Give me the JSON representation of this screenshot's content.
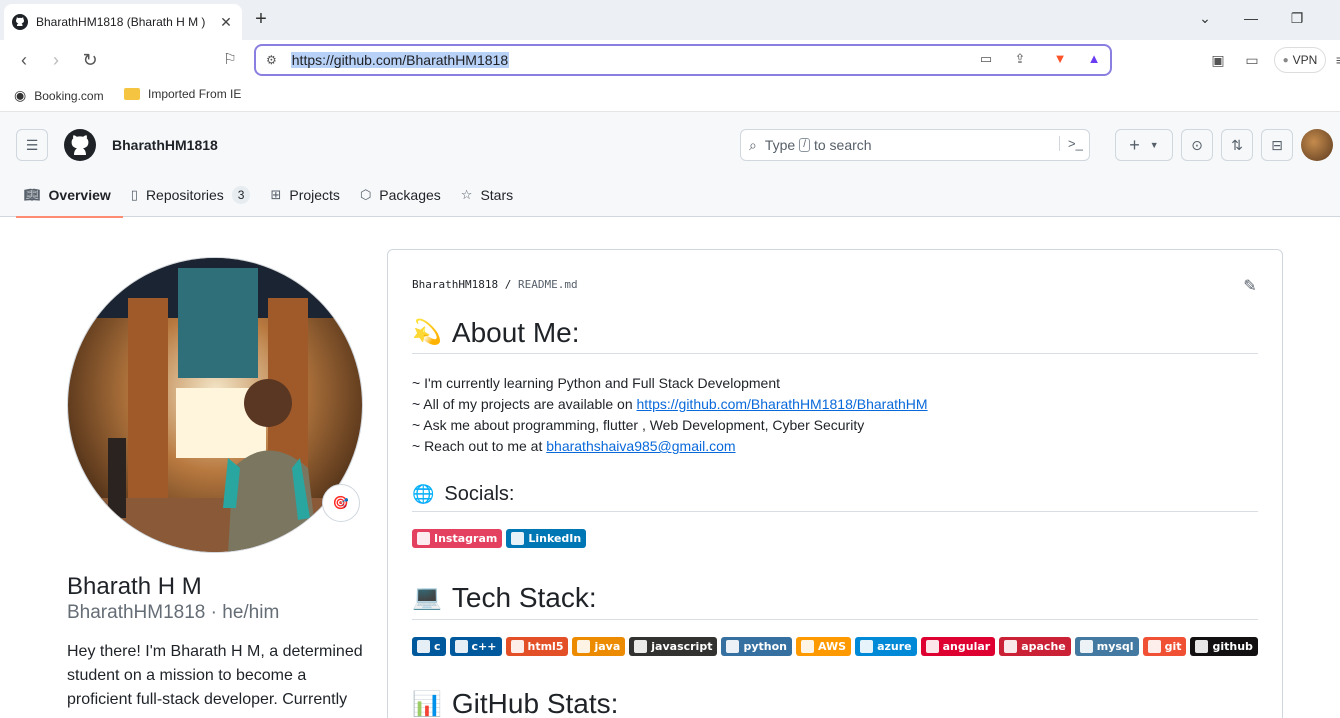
{
  "browser": {
    "tab_title": "BharathHM1818 (Bharath H M )",
    "url": "https://github.com/BharathHM1818",
    "vpn_label": "VPN",
    "bookmarks": [
      "Booking.com",
      "Imported From IE"
    ]
  },
  "header": {
    "username": "BharathHM1818",
    "search_prefix": "Type",
    "search_key": "/",
    "search_suffix": "to search",
    "plus": "+",
    "nav_tabs": [
      {
        "label": "Overview",
        "icon": "book-icon"
      },
      {
        "label": "Repositories",
        "icon": "repo-icon",
        "count": "3"
      },
      {
        "label": "Projects",
        "icon": "table-icon"
      },
      {
        "label": "Packages",
        "icon": "package-icon"
      },
      {
        "label": "Stars",
        "icon": "star-icon"
      }
    ]
  },
  "profile": {
    "name": "Bharath H M",
    "login_line": "BharathHM1818 · he/him",
    "bio": "Hey there! I'm Bharath H M, a determined student on a mission to become a proficient full-stack developer. Currently"
  },
  "readme": {
    "path_user": "BharathHM1818",
    "path_sep": "/",
    "path_file": "README.md",
    "about_title": "About Me:",
    "about_emoji": "💫",
    "lines": [
      {
        "text": "~ I'm currently learning Python and Full Stack Development",
        "link": ""
      },
      {
        "text": "~ All of my projects are available on ",
        "link": "https://github.com/BharathHM1818/BharathHM"
      },
      {
        "text": "~ Ask me about programming, flutter , Web Development, Cyber Security",
        "link": ""
      },
      {
        "text": "~ Reach out to me at ",
        "link": "bharathshaiva985@gmail.com"
      }
    ],
    "socials_title": "Socials:",
    "socials_emoji": "🌐",
    "socials": [
      {
        "label": "Instagram",
        "color": "#E4405F"
      },
      {
        "label": "LinkedIn",
        "color": "#0077B5"
      }
    ],
    "tech_title": "Tech Stack:",
    "tech_emoji": "💻",
    "tech": [
      {
        "label": "c",
        "color": "#00599C"
      },
      {
        "label": "c++",
        "color": "#00599C"
      },
      {
        "label": "html5",
        "color": "#E34F26"
      },
      {
        "label": "java",
        "color": "#ED8B00"
      },
      {
        "label": "javascript",
        "color": "#323330"
      },
      {
        "label": "python",
        "color": "#3670A0"
      },
      {
        "label": "AWS",
        "color": "#FF9900"
      },
      {
        "label": "azure",
        "color": "#0089D6"
      },
      {
        "label": "angular",
        "color": "#DD0031"
      },
      {
        "label": "apache",
        "color": "#CA2136"
      },
      {
        "label": "mysql",
        "color": "#4479A1"
      },
      {
        "label": "git",
        "color": "#F05033"
      },
      {
        "label": "github",
        "color": "#121011"
      }
    ],
    "stats_title": "GitHub Stats:",
    "stats_emoji": "📊"
  }
}
